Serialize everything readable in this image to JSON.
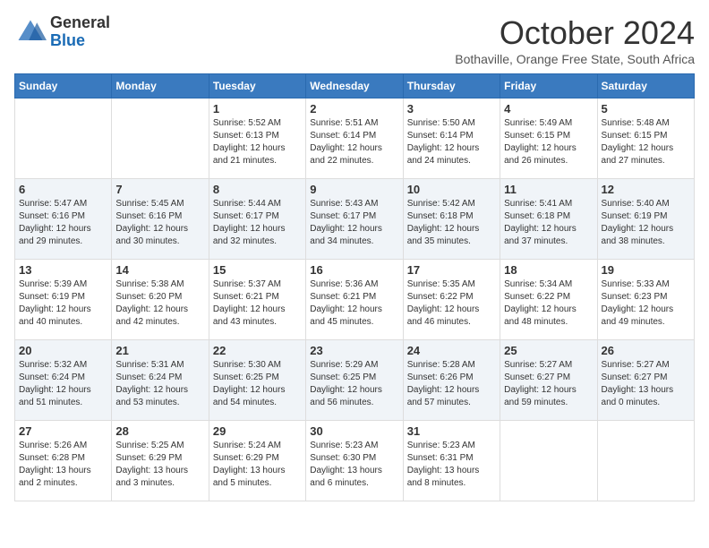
{
  "logo": {
    "general": "General",
    "blue": "Blue"
  },
  "header": {
    "month": "October 2024",
    "subtitle": "Bothaville, Orange Free State, South Africa"
  },
  "weekdays": [
    "Sunday",
    "Monday",
    "Tuesday",
    "Wednesday",
    "Thursday",
    "Friday",
    "Saturday"
  ],
  "weeks": [
    [
      {
        "day": "",
        "sunrise": "",
        "sunset": "",
        "daylight": ""
      },
      {
        "day": "",
        "sunrise": "",
        "sunset": "",
        "daylight": ""
      },
      {
        "day": "1",
        "sunrise": "Sunrise: 5:52 AM",
        "sunset": "Sunset: 6:13 PM",
        "daylight": "Daylight: 12 hours and 21 minutes."
      },
      {
        "day": "2",
        "sunrise": "Sunrise: 5:51 AM",
        "sunset": "Sunset: 6:14 PM",
        "daylight": "Daylight: 12 hours and 22 minutes."
      },
      {
        "day": "3",
        "sunrise": "Sunrise: 5:50 AM",
        "sunset": "Sunset: 6:14 PM",
        "daylight": "Daylight: 12 hours and 24 minutes."
      },
      {
        "day": "4",
        "sunrise": "Sunrise: 5:49 AM",
        "sunset": "Sunset: 6:15 PM",
        "daylight": "Daylight: 12 hours and 26 minutes."
      },
      {
        "day": "5",
        "sunrise": "Sunrise: 5:48 AM",
        "sunset": "Sunset: 6:15 PM",
        "daylight": "Daylight: 12 hours and 27 minutes."
      }
    ],
    [
      {
        "day": "6",
        "sunrise": "Sunrise: 5:47 AM",
        "sunset": "Sunset: 6:16 PM",
        "daylight": "Daylight: 12 hours and 29 minutes."
      },
      {
        "day": "7",
        "sunrise": "Sunrise: 5:45 AM",
        "sunset": "Sunset: 6:16 PM",
        "daylight": "Daylight: 12 hours and 30 minutes."
      },
      {
        "day": "8",
        "sunrise": "Sunrise: 5:44 AM",
        "sunset": "Sunset: 6:17 PM",
        "daylight": "Daylight: 12 hours and 32 minutes."
      },
      {
        "day": "9",
        "sunrise": "Sunrise: 5:43 AM",
        "sunset": "Sunset: 6:17 PM",
        "daylight": "Daylight: 12 hours and 34 minutes."
      },
      {
        "day": "10",
        "sunrise": "Sunrise: 5:42 AM",
        "sunset": "Sunset: 6:18 PM",
        "daylight": "Daylight: 12 hours and 35 minutes."
      },
      {
        "day": "11",
        "sunrise": "Sunrise: 5:41 AM",
        "sunset": "Sunset: 6:18 PM",
        "daylight": "Daylight: 12 hours and 37 minutes."
      },
      {
        "day": "12",
        "sunrise": "Sunrise: 5:40 AM",
        "sunset": "Sunset: 6:19 PM",
        "daylight": "Daylight: 12 hours and 38 minutes."
      }
    ],
    [
      {
        "day": "13",
        "sunrise": "Sunrise: 5:39 AM",
        "sunset": "Sunset: 6:19 PM",
        "daylight": "Daylight: 12 hours and 40 minutes."
      },
      {
        "day": "14",
        "sunrise": "Sunrise: 5:38 AM",
        "sunset": "Sunset: 6:20 PM",
        "daylight": "Daylight: 12 hours and 42 minutes."
      },
      {
        "day": "15",
        "sunrise": "Sunrise: 5:37 AM",
        "sunset": "Sunset: 6:21 PM",
        "daylight": "Daylight: 12 hours and 43 minutes."
      },
      {
        "day": "16",
        "sunrise": "Sunrise: 5:36 AM",
        "sunset": "Sunset: 6:21 PM",
        "daylight": "Daylight: 12 hours and 45 minutes."
      },
      {
        "day": "17",
        "sunrise": "Sunrise: 5:35 AM",
        "sunset": "Sunset: 6:22 PM",
        "daylight": "Daylight: 12 hours and 46 minutes."
      },
      {
        "day": "18",
        "sunrise": "Sunrise: 5:34 AM",
        "sunset": "Sunset: 6:22 PM",
        "daylight": "Daylight: 12 hours and 48 minutes."
      },
      {
        "day": "19",
        "sunrise": "Sunrise: 5:33 AM",
        "sunset": "Sunset: 6:23 PM",
        "daylight": "Daylight: 12 hours and 49 minutes."
      }
    ],
    [
      {
        "day": "20",
        "sunrise": "Sunrise: 5:32 AM",
        "sunset": "Sunset: 6:24 PM",
        "daylight": "Daylight: 12 hours and 51 minutes."
      },
      {
        "day": "21",
        "sunrise": "Sunrise: 5:31 AM",
        "sunset": "Sunset: 6:24 PM",
        "daylight": "Daylight: 12 hours and 53 minutes."
      },
      {
        "day": "22",
        "sunrise": "Sunrise: 5:30 AM",
        "sunset": "Sunset: 6:25 PM",
        "daylight": "Daylight: 12 hours and 54 minutes."
      },
      {
        "day": "23",
        "sunrise": "Sunrise: 5:29 AM",
        "sunset": "Sunset: 6:25 PM",
        "daylight": "Daylight: 12 hours and 56 minutes."
      },
      {
        "day": "24",
        "sunrise": "Sunrise: 5:28 AM",
        "sunset": "Sunset: 6:26 PM",
        "daylight": "Daylight: 12 hours and 57 minutes."
      },
      {
        "day": "25",
        "sunrise": "Sunrise: 5:27 AM",
        "sunset": "Sunset: 6:27 PM",
        "daylight": "Daylight: 12 hours and 59 minutes."
      },
      {
        "day": "26",
        "sunrise": "Sunrise: 5:27 AM",
        "sunset": "Sunset: 6:27 PM",
        "daylight": "Daylight: 13 hours and 0 minutes."
      }
    ],
    [
      {
        "day": "27",
        "sunrise": "Sunrise: 5:26 AM",
        "sunset": "Sunset: 6:28 PM",
        "daylight": "Daylight: 13 hours and 2 minutes."
      },
      {
        "day": "28",
        "sunrise": "Sunrise: 5:25 AM",
        "sunset": "Sunset: 6:29 PM",
        "daylight": "Daylight: 13 hours and 3 minutes."
      },
      {
        "day": "29",
        "sunrise": "Sunrise: 5:24 AM",
        "sunset": "Sunset: 6:29 PM",
        "daylight": "Daylight: 13 hours and 5 minutes."
      },
      {
        "day": "30",
        "sunrise": "Sunrise: 5:23 AM",
        "sunset": "Sunset: 6:30 PM",
        "daylight": "Daylight: 13 hours and 6 minutes."
      },
      {
        "day": "31",
        "sunrise": "Sunrise: 5:23 AM",
        "sunset": "Sunset: 6:31 PM",
        "daylight": "Daylight: 13 hours and 8 minutes."
      },
      {
        "day": "",
        "sunrise": "",
        "sunset": "",
        "daylight": ""
      },
      {
        "day": "",
        "sunrise": "",
        "sunset": "",
        "daylight": ""
      }
    ]
  ]
}
